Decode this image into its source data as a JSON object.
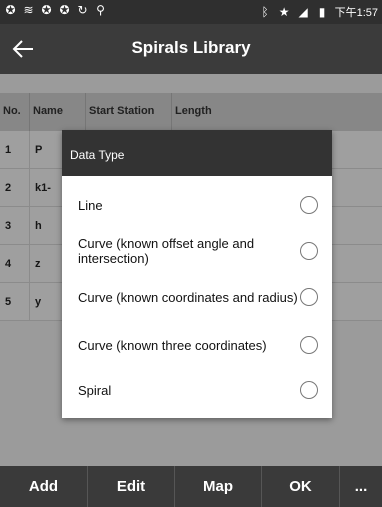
{
  "status_bar": {
    "time": "下午1:57"
  },
  "app_bar": {
    "title": "Spirals Library",
    "back_icon": "arrow-left-icon"
  },
  "table": {
    "headers": [
      "No.",
      "Name",
      "Start Station",
      "Length"
    ],
    "rows": [
      {
        "no": "1",
        "name": "P"
      },
      {
        "no": "2",
        "name": "k1-"
      },
      {
        "no": "3",
        "name": "h"
      },
      {
        "no": "4",
        "name": "z"
      },
      {
        "no": "5",
        "name": "y"
      }
    ]
  },
  "dialog": {
    "title": "Data Type",
    "options": [
      "Line",
      "Curve (known offset angle and intersection)",
      "Curve (known coordinates and radius)",
      "Curve (known three coordinates)",
      "Spiral"
    ]
  },
  "bottom_bar": {
    "buttons": [
      "Add",
      "Edit",
      "Map",
      "OK",
      "..."
    ]
  }
}
